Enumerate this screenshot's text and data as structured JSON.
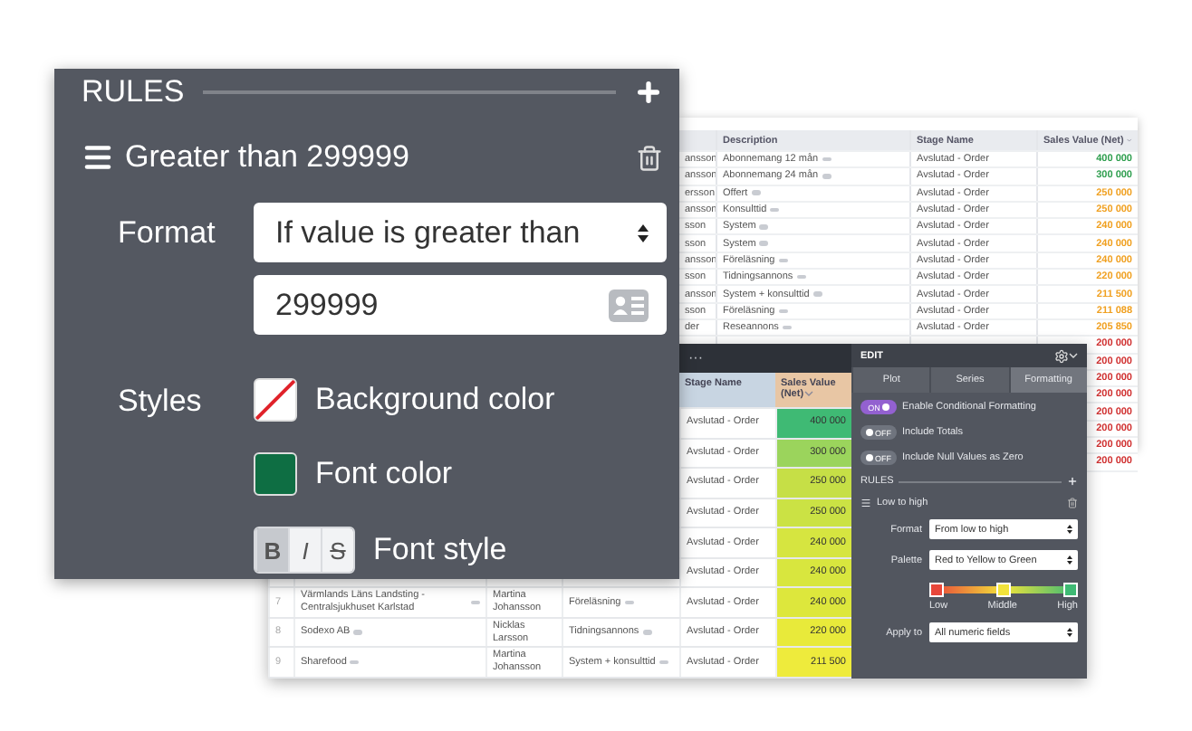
{
  "background_table": {
    "columns": [
      "",
      "Description",
      "Stage Name",
      "Sales Value (Net)"
    ],
    "rows": [
      {
        "cells": [
          "ansson",
          "Abonnemang 12 mån",
          "Avslutad - Order",
          "400 000"
        ],
        "color": "#2e9e4e"
      },
      {
        "cells": [
          "ansson",
          "Abonnemang 24 mån",
          "Avslutad - Order",
          "300 000"
        ],
        "color": "#2e9e4e"
      },
      {
        "cells": [
          "ersson",
          "Offert",
          "Avslutad - Order",
          "250 000"
        ],
        "color": "#f0a020"
      },
      {
        "cells": [
          "ansson",
          "Konsulttid",
          "Avslutad - Order",
          "250 000"
        ],
        "color": "#f0a020"
      },
      {
        "cells": [
          "sson",
          "System",
          "Avslutad - Order",
          "240 000"
        ],
        "color": "#f0a020"
      },
      {
        "cells": [
          "sson",
          "System",
          "Avslutad - Order",
          "240 000"
        ],
        "color": "#f0a020"
      },
      {
        "cells": [
          "ansson",
          "Föreläsning",
          "Avslutad - Order",
          "240 000"
        ],
        "color": "#f0a020"
      },
      {
        "cells": [
          "sson",
          "Tidningsannons",
          "Avslutad - Order",
          "220 000"
        ],
        "color": "#f0a020"
      },
      {
        "cells": [
          "ansson",
          "System + konsulttid",
          "Avslutad - Order",
          "211 500"
        ],
        "color": "#f0a020"
      },
      {
        "cells": [
          "sson",
          "Föreläsning",
          "Avslutad - Order",
          "211 088"
        ],
        "color": "#f0a020"
      },
      {
        "cells": [
          "der",
          "Reseannons",
          "Avslutad - Order",
          "205 850"
        ],
        "color": "#f0a020"
      }
    ],
    "value_only_rows": [
      {
        "value": "200 000",
        "color": "#d03030"
      },
      {
        "value": "200 000",
        "color": "#d03030"
      },
      {
        "value": "200 000",
        "color": "#d03030"
      },
      {
        "value": "200 000",
        "color": "#d03030"
      },
      {
        "value": "200 000",
        "color": "#d03030"
      },
      {
        "value": "200 000",
        "color": "#d03030"
      },
      {
        "value": "200 000",
        "color": "#d03030"
      },
      {
        "value": "200 000",
        "color": "#d03030"
      }
    ]
  },
  "report": {
    "menu_glyph": "···",
    "columns": [
      "Stage Name",
      "Sales Value (Net)"
    ],
    "rows": [
      {
        "stage": "Avslutad - Order",
        "value": "400 000",
        "color": "#3fba74"
      },
      {
        "stage": "Avslutad - Order",
        "value": "300 000",
        "color": "#9bd45c"
      },
      {
        "stage": "Avslutad - Order",
        "value": "250 000",
        "color": "#c6df46"
      },
      {
        "stage": "Avslutad - Order",
        "value": "250 000",
        "color": "#cbe244"
      },
      {
        "stage": "Avslutad - Order",
        "value": "240 000",
        "color": "#d6e540"
      },
      {
        "stage": "Avslutad - Order",
        "value": "240 000",
        "color": "#d8e63e"
      },
      {
        "number": "7",
        "name": "Värmlands Läns Landsting - Centralsjukhuset Karlstad",
        "person": "Martina Johansson",
        "description": "Föreläsning",
        "stage": "Avslutad - Order",
        "value": "240 000",
        "color": "#dde73c"
      },
      {
        "number": "8",
        "name": "Sodexo AB",
        "person": "Nicklas Larsson",
        "description": "Tidningsannons",
        "stage": "Avslutad - Order",
        "value": "220 000",
        "color": "#e8ea3a"
      },
      {
        "number": "9",
        "name": "Sharefood",
        "person": "Martina Johansson",
        "description": "System + konsulttid",
        "stage": "Avslutad - Order",
        "value": "211 500",
        "color": "#eeeb3c"
      }
    ]
  },
  "edit_panel": {
    "title": "EDIT",
    "tabs": [
      {
        "label": "Plot",
        "selected": false
      },
      {
        "label": "Series",
        "selected": false
      },
      {
        "label": "Formatting",
        "selected": true
      }
    ],
    "toggles": [
      {
        "state": "ON",
        "on": true,
        "label": "Enable Conditional Formatting"
      },
      {
        "state": "OFF",
        "on": false,
        "label": "Include Totals"
      },
      {
        "state": "OFF",
        "on": false,
        "label": "Include Null Values as Zero"
      }
    ],
    "rules_title": "RULES",
    "rule_name": "Low to high",
    "fields": [
      {
        "label": "Format",
        "value": "From low to high"
      },
      {
        "label": "Palette",
        "value": "Red to Yellow to Green"
      }
    ],
    "palette_stops": [
      {
        "label": "Low",
        "color": "#e8463a"
      },
      {
        "label": "Middle",
        "color": "#f2e33a"
      },
      {
        "label": "High",
        "color": "#3fba74"
      }
    ],
    "apply": {
      "label": "Apply to",
      "value": "All numeric fields"
    }
  },
  "rules_panel": {
    "title": "RULES",
    "rule_name": "Greater than 299999",
    "format_label": "Format",
    "condition": "If value is greater than",
    "threshold": "299999",
    "styles_label": "Styles",
    "styles": [
      {
        "kind": "empty-swatch",
        "label": "Background color"
      },
      {
        "kind": "color-swatch",
        "label": "Font color",
        "color": "#0e6e43"
      }
    ],
    "font_style": {
      "label": "Font style",
      "buttons": [
        {
          "label": "B",
          "selected": true
        },
        {
          "label": "I",
          "selected": false
        },
        {
          "label": "S",
          "selected": false
        }
      ]
    }
  }
}
